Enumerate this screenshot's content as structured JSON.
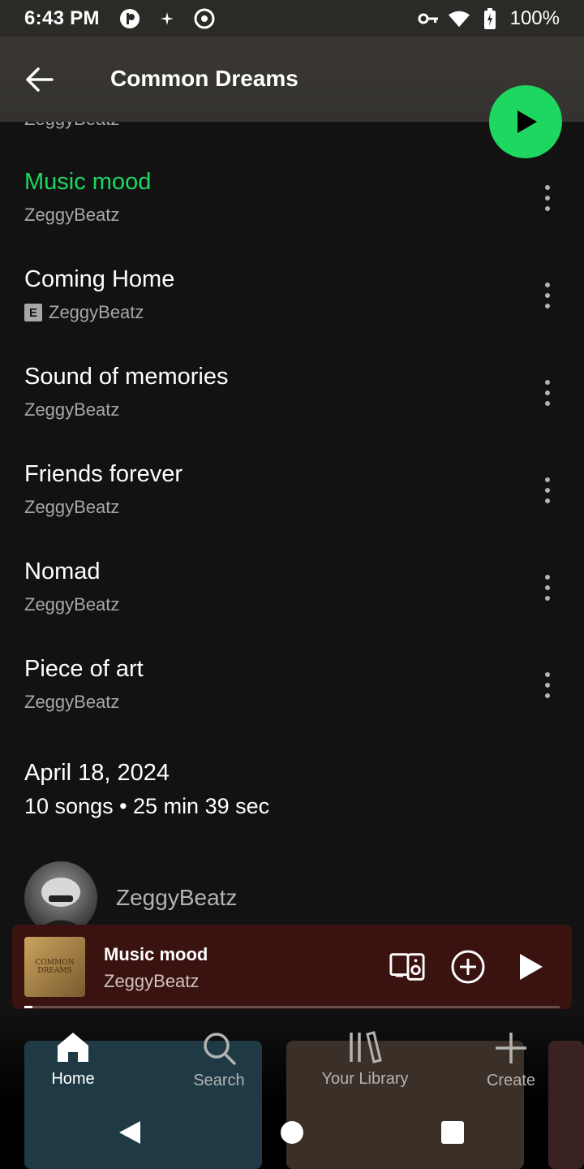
{
  "status": {
    "time": "6:43 PM",
    "battery": "100%"
  },
  "header": {
    "title": "Common Dreams"
  },
  "cut_row_artist": "ZeggyBeatz",
  "tracks": [
    {
      "title": "Music mood",
      "artist": "ZeggyBeatz",
      "explicit": false,
      "playing": true
    },
    {
      "title": "Coming Home",
      "artist": "ZeggyBeatz",
      "explicit": true,
      "playing": false
    },
    {
      "title": "Sound of memories",
      "artist": "ZeggyBeatz",
      "explicit": false,
      "playing": false
    },
    {
      "title": "Friends forever",
      "artist": "ZeggyBeatz",
      "explicit": false,
      "playing": false
    },
    {
      "title": "Nomad",
      "artist": "ZeggyBeatz",
      "explicit": false,
      "playing": false
    },
    {
      "title": "Piece of art",
      "artist": "ZeggyBeatz",
      "explicit": false,
      "playing": false
    }
  ],
  "explicit_label": "E",
  "playlist_meta": {
    "date": "April 18, 2024",
    "stats": "10 songs • 25 min 39 sec"
  },
  "owner": {
    "name": "ZeggyBeatz"
  },
  "mini_player": {
    "title": "Music mood",
    "artist": "ZeggyBeatz",
    "art_text": "COMMON DREAMS",
    "progress_fraction": 0.015
  },
  "nav": {
    "home": "Home",
    "search": "Search",
    "library": "Your Library",
    "create": "Create"
  },
  "colors": {
    "accent": "#1ed760",
    "background": "#121212",
    "mini_player_bg": "#3a1311"
  }
}
